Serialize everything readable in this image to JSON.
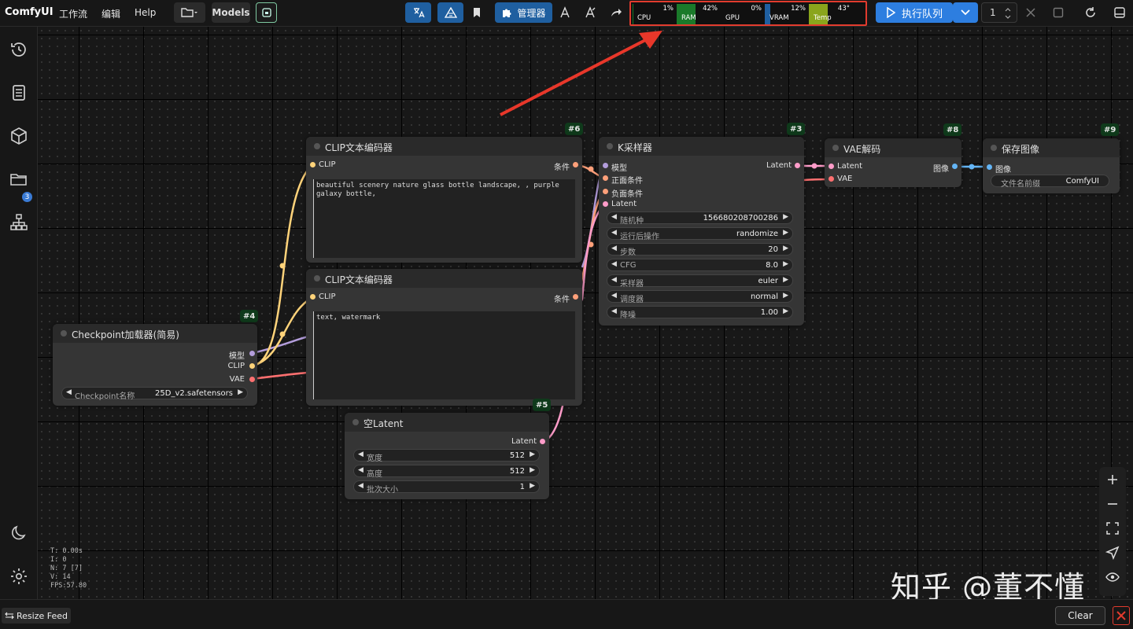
{
  "app": {
    "brand": "ComfyUI"
  },
  "menu": {
    "workflow": "工作流",
    "edit": "编辑",
    "help": "Help"
  },
  "toolbar": {
    "models_label": "Models",
    "manager_label": "管理器",
    "queue_label": "执行队列",
    "batch_count": "1"
  },
  "monitor": {
    "cpu": {
      "label": "CPU",
      "value": "1%",
      "percent": 1
    },
    "ram": {
      "label": "RAM",
      "value": "42%",
      "percent": 42,
      "color": "#1a7a2a"
    },
    "gpu": {
      "label": "GPU",
      "value": "0%",
      "percent": 0
    },
    "vram": {
      "label": "VRAM",
      "value": "12%",
      "percent": 12,
      "color": "#1f5fa0"
    },
    "temp": {
      "label": "Temp",
      "value": "43°",
      "percent": 43,
      "color": "#8aa51c"
    }
  },
  "sidebar": {
    "badge": "3"
  },
  "nodes": {
    "clip6": {
      "id": "#6",
      "title": "CLIP文本编码器",
      "in_clip": "CLIP",
      "out_cond": "条件",
      "text": "beautiful scenery nature glass bottle landscape, , purple galaxy bottle,"
    },
    "clip7": {
      "title": "CLIP文本编码器",
      "in_clip": "CLIP",
      "out_cond": "条件",
      "text": "text, watermark"
    },
    "ksampler": {
      "id": "#3",
      "title": "K采样器",
      "inputs": [
        "模型",
        "正面条件",
        "负面条件",
        "Latent"
      ],
      "output": "Latent",
      "widgets": [
        {
          "label": "随机种",
          "value": "156680208700286"
        },
        {
          "label": "运行后操作",
          "value": "randomize"
        },
        {
          "label": "步数",
          "value": "20"
        },
        {
          "label": "CFG",
          "value": "8.0"
        },
        {
          "label": "采样器",
          "value": "euler"
        },
        {
          "label": "调度器",
          "value": "normal"
        },
        {
          "label": "降噪",
          "value": "1.00"
        }
      ]
    },
    "vae": {
      "id": "#8",
      "title": "VAE解码",
      "in_latent": "Latent",
      "in_vae": "VAE",
      "out_image": "图像"
    },
    "save": {
      "id": "#9",
      "title": "保存图像",
      "in_image": "图像",
      "prefix_label": "文件名前缀",
      "prefix_value": "ComfyUI"
    },
    "checkpoint": {
      "id": "#4",
      "title": "Checkpoint加载器(简易)",
      "outputs": [
        "模型",
        "CLIP",
        "VAE"
      ],
      "widget_label": "Checkpoint名称",
      "widget_value": "25D_v2.safetensors"
    },
    "latent": {
      "id": "#5",
      "title": "空Latent",
      "output": "Latent",
      "widgets": [
        {
          "label": "宽度",
          "value": "512"
        },
        {
          "label": "高度",
          "value": "512"
        },
        {
          "label": "批次大小",
          "value": "1"
        }
      ]
    }
  },
  "stats": {
    "t": "T: 0.00s",
    "i": "I: 0",
    "n": "N: 7 [7]",
    "v": "V: 14",
    "fps": "FPS:57.80"
  },
  "bottom": {
    "resize_feed": "Resize Feed",
    "clear": "Clear"
  },
  "watermark": "知乎 @董不懂",
  "colors": {
    "clip": "#ffd37a",
    "model": "#b39ddb",
    "vae": "#ff7070",
    "latent": "#ff9cc9",
    "cond": "#ffa07a",
    "image": "#64b5f6"
  }
}
